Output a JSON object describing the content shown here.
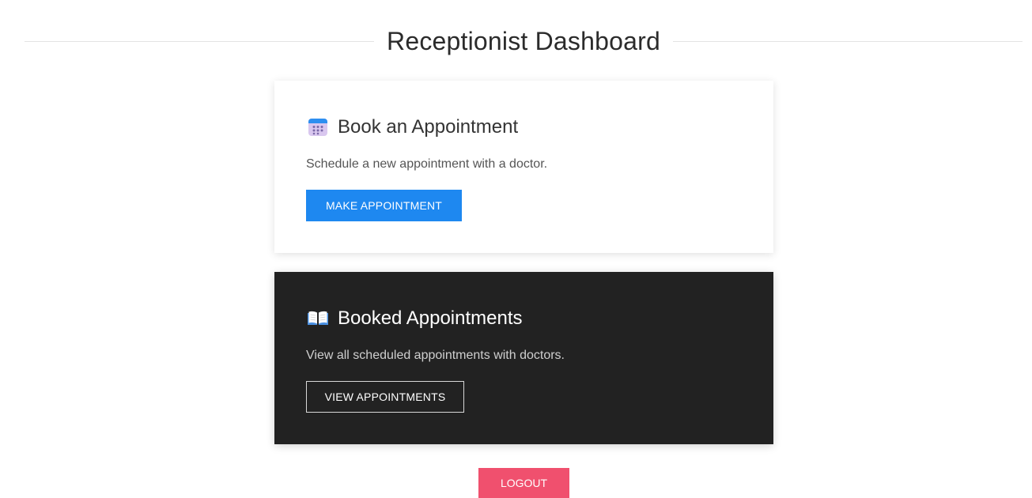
{
  "header": {
    "title": "Receptionist Dashboard"
  },
  "book_card": {
    "icon": "calendar-icon",
    "title": "Book an Appointment",
    "description": "Schedule a new appointment with a doctor.",
    "button_label": "MAKE APPOINTMENT"
  },
  "booked_card": {
    "icon": "open-book-icon",
    "title": "Booked Appointments",
    "description": "View all scheduled appointments with doctors.",
    "button_label": "VIEW APPOINTMENTS"
  },
  "logout": {
    "label": "LOGOUT"
  },
  "colors": {
    "primary_button": "#1e88f0",
    "logout_button": "#f0506e",
    "dark_card": "#222222"
  }
}
